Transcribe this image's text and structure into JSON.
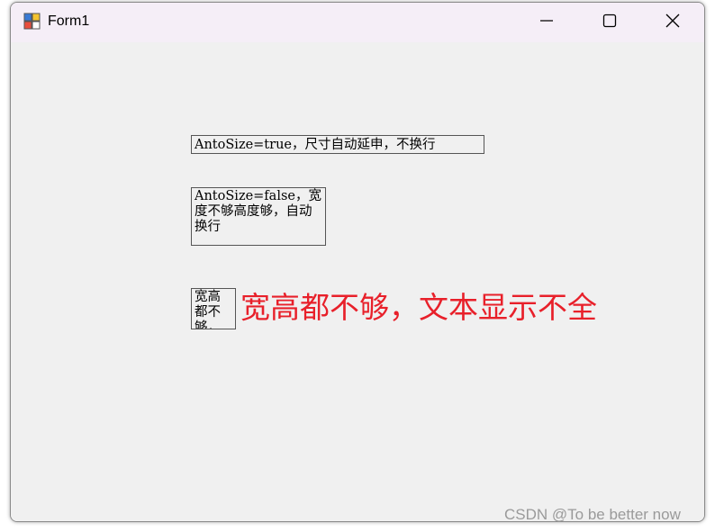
{
  "window": {
    "title": "Form1",
    "icons": {
      "app": "form-app-icon",
      "minimize": "minimize-icon",
      "maximize": "maximize-icon",
      "close": "close-icon"
    }
  },
  "labels": {
    "autosize_true": "AntoSize=true，尺寸自动延申，不换行",
    "autosize_false": "AntoSize=false，宽度不够高度够，自动换行",
    "too_small": "宽高都不够，文本显示不全"
  },
  "annotation": {
    "text": "宽高都不够，文本显示不全",
    "color": "#e8202a"
  },
  "watermark": "CSDN @To be better now"
}
